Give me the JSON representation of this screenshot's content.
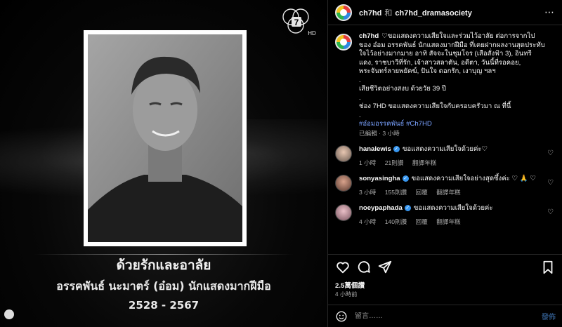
{
  "media": {
    "caption_line1": "ด้วยรักและอาลัย",
    "caption_line2": "อรรคพันธ์ นะมาตร์ (อ๋อม) นักแสดงมากฝีมือ",
    "caption_line3": "2528 - 2567",
    "logo_text": "7",
    "logo_sub": "HD"
  },
  "header": {
    "username": "ch7hd",
    "and_symbol": "和",
    "collab_username": "ch7hd_dramasociety",
    "more_icon": "more-horizontal-icon"
  },
  "post": {
    "username": "ch7hd",
    "line1": "♡ขอแสดงความเสียใจและร่วมไว้อาลัย ต่อการจากไปของ อ๋อม อรรคพันธ์ นักแสดงมากฝีมือ ที่เคยฝากผลงานสุดประทับใจไว้อย่างมากมาย อาทิ สัจจะในชุมโจร (เสือสั่งฟ้า 3), อินทรีแดง, ราชบาวีที่รัก, เจ้าสาวสลาตัน, อดีตา, วันนี้ที่รอคอย, พระจันทร์ลายพยัคฆ์, ปันใจ ดอกรัก, เงาบุญ ฯลฯ",
    "dot1": ".",
    "line2": "เสียชีวิตอย่างสงบ ด้วยวัย 39 ปี",
    "dot2": ".",
    "line3": "ช่อง 7HD ขอแสดงความเสียใจกับครอบครัวมา ณ ที่นี้",
    "dot3": ".",
    "hashtags": "#อ๋อมอรรคพันธ์ #Ch7HD",
    "meta_edited": "已編輯 · 3 小時"
  },
  "comments": [
    {
      "username": "hanalewis",
      "text": "ขอแสดงความเสียใจด้วยค่ะ♡",
      "time": "1 小時",
      "likes": "21則讚",
      "reply": "翻譯年糕"
    },
    {
      "username": "sonyasingha",
      "text": "ขอแสดงความเสียใจอย่างสุดซึ้งค่ะ ♡ 🙏 ♡",
      "time": "3 小時",
      "likes": "155則讚",
      "reply": "回覆",
      "translate": "翻譯年糕"
    },
    {
      "username": "noeypaphada",
      "text": "ขอแสดงความเสียใจด้วยค่ะ",
      "time": "4 小時",
      "likes": "140則讚",
      "reply": "回覆",
      "translate": "翻譯年糕"
    }
  ],
  "actions": {
    "like_icon": "heart-icon",
    "comment_icon": "comment-icon",
    "share_icon": "share-icon",
    "save_icon": "bookmark-icon"
  },
  "likes_count": "2.5萬個讚",
  "time_ago": "4 小時前",
  "compose": {
    "placeholder": "留言……",
    "post_label": "發佈",
    "emoji_icon": "emoji-icon"
  },
  "colors": {
    "background": "#000000",
    "hashtag": "#7aa2ff",
    "verified": "#3897f0",
    "muted": "#a8a8a8"
  }
}
